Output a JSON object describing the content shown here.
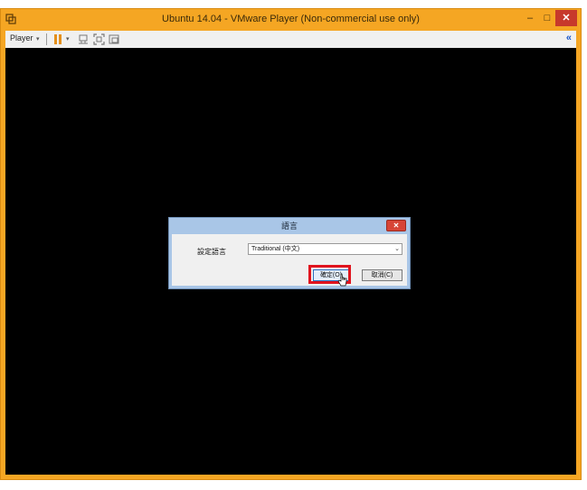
{
  "window": {
    "title": "Ubuntu 14.04 - VMware Player (Non-commercial use only)",
    "minimize": "–",
    "maximize": "□",
    "close": "✕"
  },
  "toolbar": {
    "player_label": "Player",
    "caret": "▾",
    "collapse": "«"
  },
  "dialog": {
    "title": "語言",
    "close": "✕",
    "label": "設定語言",
    "language_value": "Traditional (中文)",
    "dropdown": "⌄",
    "ok_label": "確定(O)",
    "cancel_label": "取消(C)"
  },
  "colors": {
    "title_bar": "#f5a623",
    "screen": "#000000",
    "highlight": "#e0141e"
  }
}
